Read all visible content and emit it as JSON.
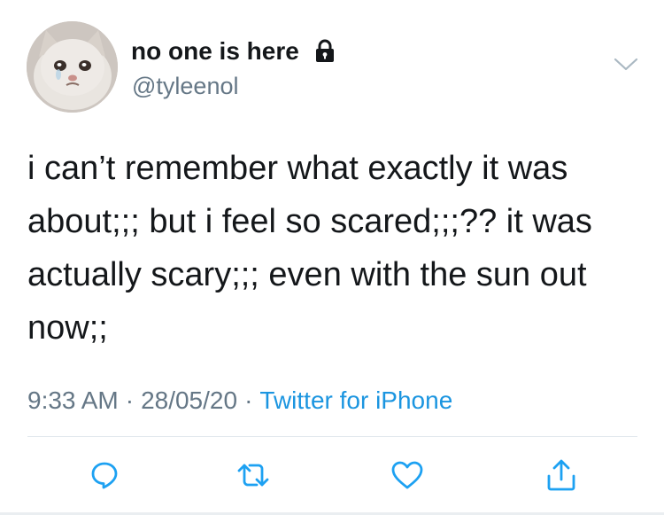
{
  "user": {
    "display_name": "no one is here",
    "handle": "@tyleenol",
    "protected_icon": "lock-icon"
  },
  "tweet": {
    "text": "i can’t remember what exactly it was about;;; but i feel so scared;;;?? it was actually scary;;; even with the sun out now;;",
    "time": "9:33 AM",
    "date": "28/05/20",
    "separator": "·",
    "source": "Twitter for iPhone"
  },
  "actions": [
    {
      "name": "reply",
      "icon": "reply-icon"
    },
    {
      "name": "retweet",
      "icon": "retweet-icon"
    },
    {
      "name": "like",
      "icon": "heart-icon"
    },
    {
      "name": "share",
      "icon": "share-icon"
    }
  ],
  "colors": {
    "text": "#14171a",
    "secondary": "#657786",
    "link": "#1b95e0",
    "icon": "#1da1f2",
    "divider": "#e1e8ed"
  }
}
